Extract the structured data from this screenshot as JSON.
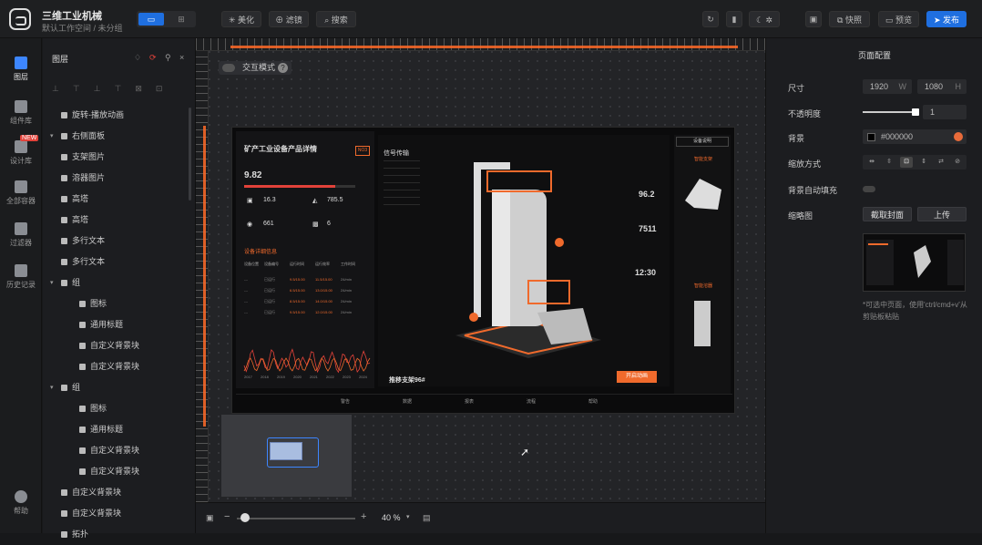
{
  "app": {
    "title": "三维工业机械",
    "subtitle": "默认工作空间 / 未分组"
  },
  "toolbar": {
    "beautify": "美化",
    "filter": "滤镜",
    "search": "搜索",
    "snapshot": "快照",
    "preview": "预览",
    "publish": "发布"
  },
  "leftnav": [
    {
      "label": "图层",
      "icon": "layers-icon"
    },
    {
      "label": "组件库",
      "icon": "component-icon"
    },
    {
      "label": "设计库",
      "icon": "design-icon",
      "badge": "NEW"
    },
    {
      "label": "全部容器",
      "icon": "container-icon"
    },
    {
      "label": "过滤器",
      "icon": "filter-icon"
    },
    {
      "label": "历史记录",
      "icon": "history-icon"
    },
    {
      "label": "帮助",
      "icon": "help-icon"
    }
  ],
  "layers": {
    "title": "图层",
    "items": [
      {
        "label": "旋转-播放动画",
        "level": 0,
        "caret": ""
      },
      {
        "label": "右侧面板",
        "level": 0,
        "caret": "▾"
      },
      {
        "label": "支架图片",
        "level": 1,
        "caret": ""
      },
      {
        "label": "溶器图片",
        "level": 1,
        "caret": ""
      },
      {
        "label": "高塔",
        "level": 1,
        "caret": ""
      },
      {
        "label": "高塔",
        "level": 1,
        "caret": ""
      },
      {
        "label": "多行文本",
        "level": 1,
        "caret": ""
      },
      {
        "label": "多行文本",
        "level": 1,
        "caret": ""
      },
      {
        "label": "组",
        "level": 1,
        "caret": "▾"
      },
      {
        "label": "图标",
        "level": 2,
        "caret": ""
      },
      {
        "label": "通用标题",
        "level": 2,
        "caret": ""
      },
      {
        "label": "自定义背景块",
        "level": 2,
        "caret": ""
      },
      {
        "label": "自定义背景块",
        "level": 2,
        "caret": ""
      },
      {
        "label": "组",
        "level": 1,
        "caret": "▾"
      },
      {
        "label": "图标",
        "level": 2,
        "caret": ""
      },
      {
        "label": "通用标题",
        "level": 2,
        "caret": ""
      },
      {
        "label": "自定义背景块",
        "level": 2,
        "caret": ""
      },
      {
        "label": "自定义背景块",
        "level": 2,
        "caret": ""
      },
      {
        "label": "自定义背景块",
        "level": 1,
        "caret": ""
      },
      {
        "label": "自定义背景块",
        "level": 1,
        "caret": ""
      },
      {
        "label": "拓扑",
        "level": 1,
        "caret": ""
      }
    ]
  },
  "canvas": {
    "interaction_mode": "交互模式",
    "zoom": "40 %"
  },
  "dashboard": {
    "title": "矿产工业设备产品详情",
    "tag": "NO3",
    "big_value": "9.82",
    "metrics": [
      {
        "value": "16.3"
      },
      {
        "value": "785.5"
      },
      {
        "value": "661"
      },
      {
        "value": "6"
      }
    ],
    "section": "设备详细信息",
    "table_headers": [
      "设备位置",
      "设备编号",
      "运行时间",
      "运行效率",
      "工作时间"
    ],
    "table_rows": [
      [
        "---",
        "已运行",
        "9.5/15.00",
        "11.5/15.00",
        "24/min"
      ],
      [
        "---",
        "已运行",
        "6.5/15.00",
        "13.0/15.00",
        "24/min"
      ],
      [
        "---",
        "已运行",
        "8.5/15.00",
        "14.0/15.00",
        "24/min"
      ],
      [
        "---",
        "已运行",
        "9.5/15.00",
        "12.0/15.00",
        "24/min"
      ]
    ],
    "chart_years": [
      "2017",
      "2018",
      "2019",
      "2020",
      "2021",
      "2022",
      "2023",
      "2024"
    ],
    "signal_title": "信号传输",
    "right_values": [
      {
        "value": "96.2"
      },
      {
        "value": "7511"
      },
      {
        "value": "12:30"
      }
    ],
    "device_name": "推移支架96#",
    "start_btn": "开启动画",
    "side_tag1": "智能支架",
    "side_tag2": "智能溶器",
    "side_header": "设备说明",
    "bottom_nav": [
      "警告",
      "数据",
      "报表",
      "流程",
      "帮助"
    ]
  },
  "rpanel": {
    "title": "页面配置",
    "size_label": "尺寸",
    "width": "1920",
    "height": "1080",
    "w": "W",
    "h": "H",
    "opacity_label": "不透明度",
    "opacity": "1",
    "bg_label": "背景",
    "bg_color": "#000000",
    "scale_label": "缩放方式",
    "autofill_label": "背景自动填充",
    "thumb_label": "缩略图",
    "capture_btn": "截取封面",
    "upload_btn": "上传",
    "hint": "*可选中页面，使用'ctrl/cmd+v'从剪贴板粘贴"
  }
}
